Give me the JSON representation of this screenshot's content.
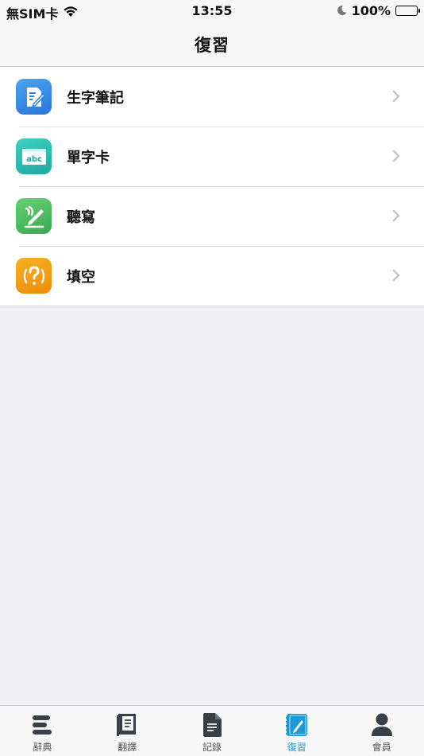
{
  "status_bar": {
    "carrier": "無SIM卡",
    "time": "13:55",
    "battery": "100%"
  },
  "nav": {
    "title": "復習"
  },
  "rows": [
    {
      "label": "生字筆記",
      "icon": "notebook-pen-icon",
      "color": "#3b8ee6"
    },
    {
      "label": "單字卡",
      "icon": "flashcard-icon",
      "color": "#2bb9b0"
    },
    {
      "label": "聽寫",
      "icon": "dictation-icon",
      "color": "#4cba63"
    },
    {
      "label": "填空",
      "icon": "question-mark-icon",
      "color": "#f29c12"
    }
  ],
  "tabs": [
    {
      "label": "辭典",
      "icon": "dictionary-icon",
      "active": false
    },
    {
      "label": "翻譯",
      "icon": "translate-book-icon",
      "active": false
    },
    {
      "label": "記錄",
      "icon": "document-icon",
      "active": false
    },
    {
      "label": "復習",
      "icon": "review-pen-icon",
      "active": true
    },
    {
      "label": "會員",
      "icon": "user-icon",
      "active": false
    }
  ],
  "colors": {
    "accent": "#1a9bd7",
    "background": "#efeff4"
  }
}
